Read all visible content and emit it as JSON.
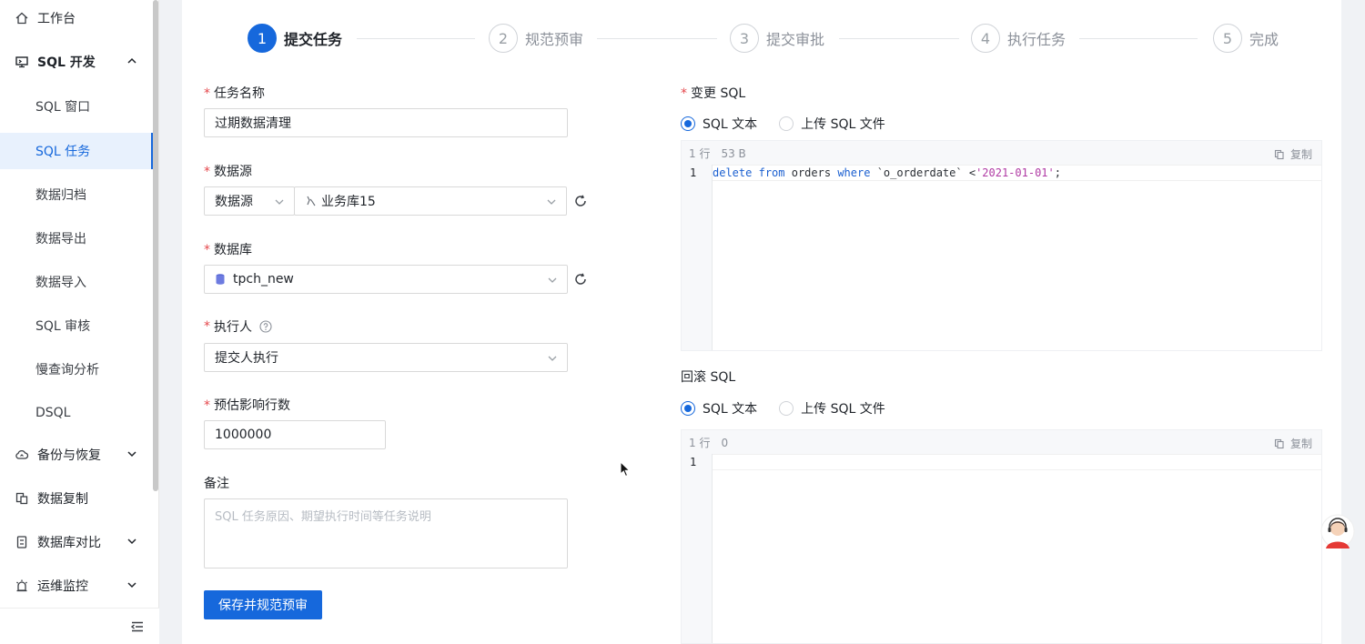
{
  "sidebar": {
    "items": [
      {
        "label": "工作台",
        "icon": "home-icon"
      },
      {
        "label": "SQL 开发",
        "icon": "monitor-icon"
      },
      {
        "label": "SQL 窗口"
      },
      {
        "label": "SQL 任务"
      },
      {
        "label": "数据归档"
      },
      {
        "label": "数据导出"
      },
      {
        "label": "数据导入"
      },
      {
        "label": "SQL 审核"
      },
      {
        "label": "慢查询分析"
      },
      {
        "label": "DSQL"
      },
      {
        "label": "备份与恢复",
        "icon": "cloud-backup-icon"
      },
      {
        "label": "数据复制",
        "icon": "copy-data-icon"
      },
      {
        "label": "数据库对比",
        "icon": "compare-icon"
      },
      {
        "label": "运维监控",
        "icon": "alarm-icon"
      }
    ],
    "active_index": 3
  },
  "steps": [
    {
      "num": "1",
      "label": "提交任务"
    },
    {
      "num": "2",
      "label": "规范预审"
    },
    {
      "num": "3",
      "label": "提交审批"
    },
    {
      "num": "4",
      "label": "执行任务"
    },
    {
      "num": "5",
      "label": "完成"
    }
  ],
  "form": {
    "task_name_label": "任务名称",
    "task_name_value": "过期数据清理",
    "datasource_label": "数据源",
    "datasource_type": "数据源",
    "datasource_value": "业务库15",
    "database_label": "数据库",
    "database_value": "tpch_new",
    "executor_label": "执行人",
    "executor_value": "提交人执行",
    "rows_label": "预估影响行数",
    "rows_value": "1000000",
    "remark_label": "备注",
    "remark_placeholder": "SQL 任务原因、期望执行时间等任务说明",
    "submit_label": "保存并规范预审"
  },
  "change_sql": {
    "label": "变更 SQL",
    "opt_text": "SQL 文本",
    "opt_file": "上传 SQL 文件",
    "lines": "1 行",
    "size": "53 B",
    "copy": "复制",
    "line_no": "1",
    "code": {
      "kw1": "delete",
      "kw2": "from",
      "t1": "orders",
      "kw3": "where",
      "t2": "`o_orderdate` <",
      "s1": "'2021-01-01'",
      "t3": ";"
    }
  },
  "rollback_sql": {
    "label": "回滚 SQL",
    "opt_text": "SQL 文本",
    "opt_file": "上传 SQL 文件",
    "lines": "1 行",
    "size": "0",
    "copy": "复制",
    "line_no": "1"
  },
  "colors": {
    "primary": "#1668dc",
    "required": "#e5484d",
    "keyword": "#1a5fd0",
    "string": "#b03aa4"
  }
}
